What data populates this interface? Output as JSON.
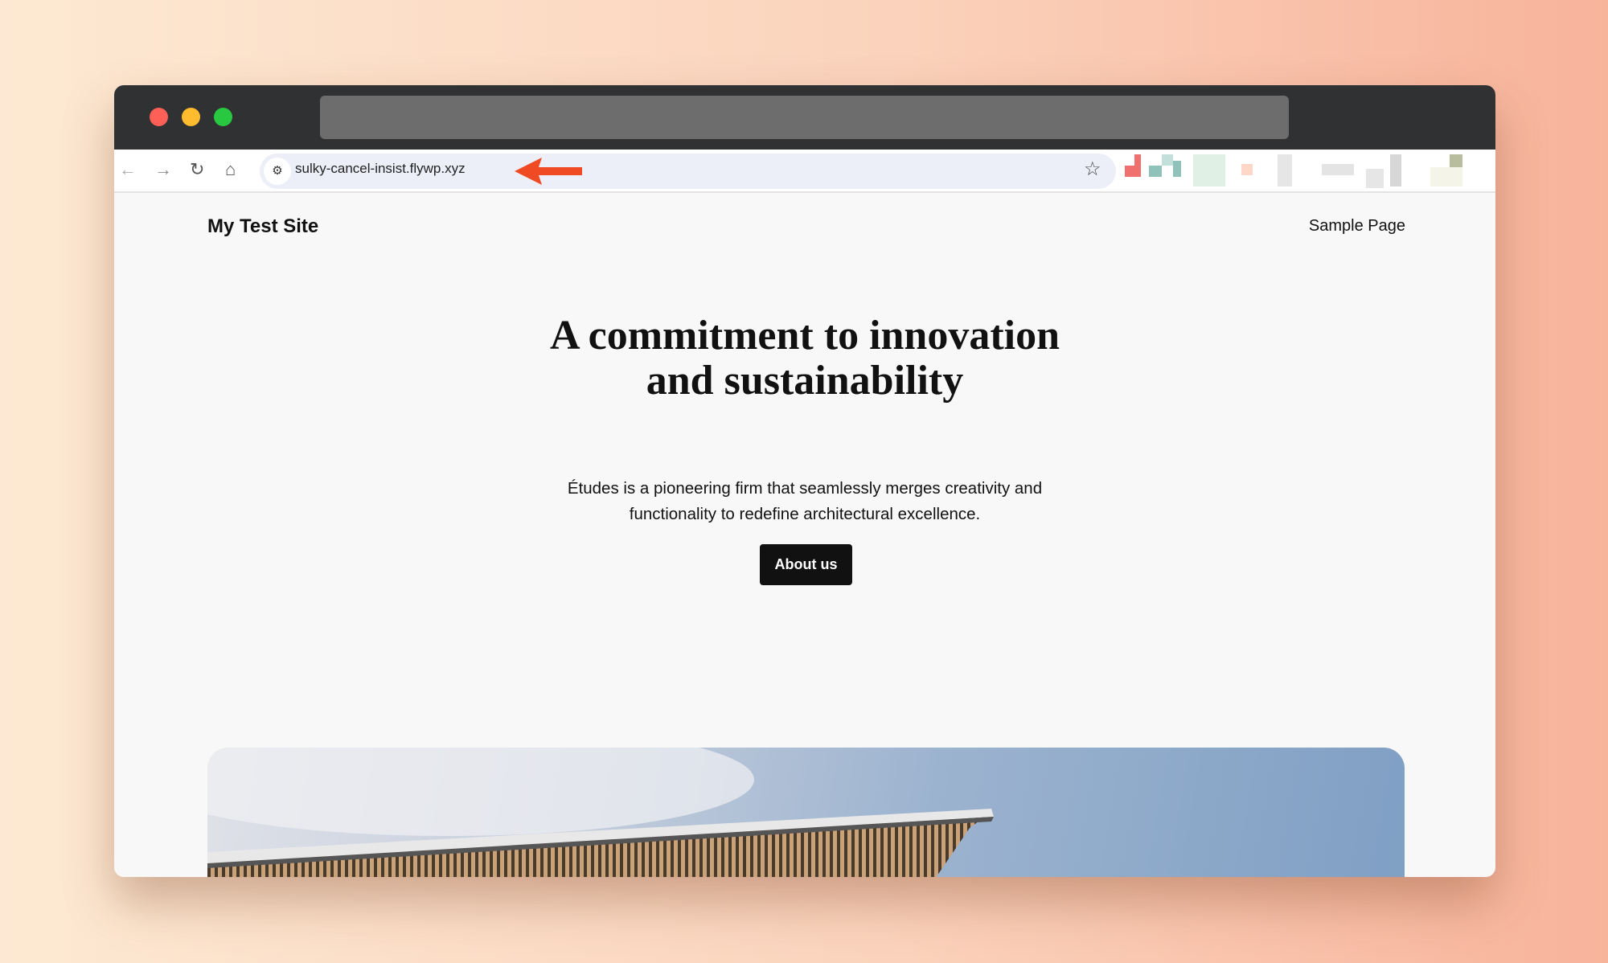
{
  "browser": {
    "url": "sulky-cancel-insist.flywp.xyz",
    "icons": [
      "back-icon",
      "forward-icon",
      "reload-icon",
      "home-icon",
      "site-settings-icon",
      "bookmark-star-icon"
    ],
    "annotation_arrow_color": "#f04a24"
  },
  "site": {
    "title": "My Test Site",
    "nav": [
      "Sample Page"
    ]
  },
  "hero": {
    "heading_line1": "A commitment to innovation",
    "heading_line2": "and sustainability",
    "text_line1": "Études is a pioneering firm that seamlessly merges creativity and",
    "text_line2": "functionality to redefine architectural excellence.",
    "button": "About us"
  }
}
